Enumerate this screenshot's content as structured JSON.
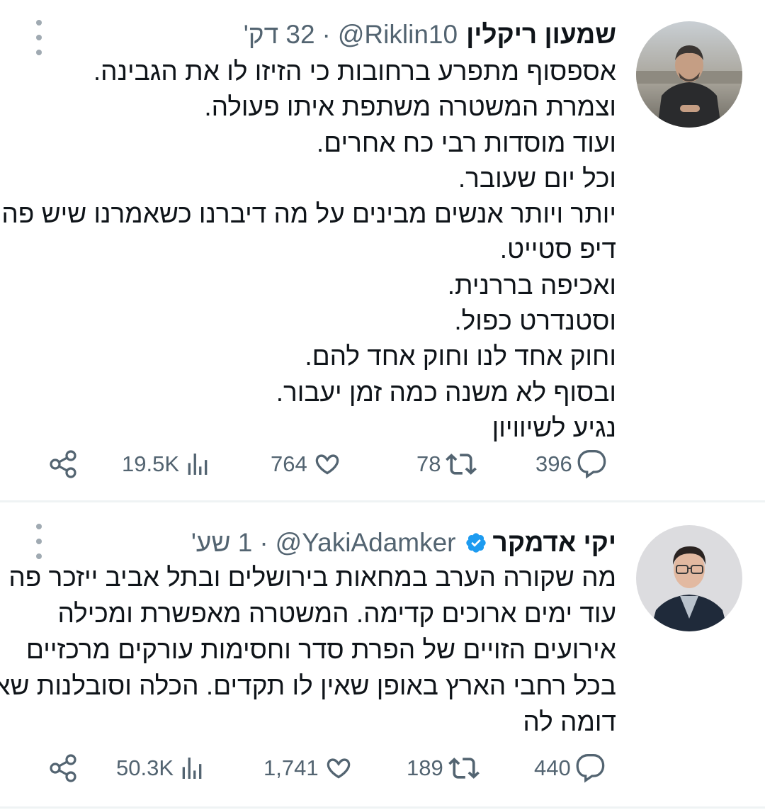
{
  "tweets": [
    {
      "author_name": "שמעון ריקלין",
      "handle": "@Riklin10",
      "time": "32 דק'",
      "verified": false,
      "lines": [
        "אספסוף מתפרע ברחובות כי הזיזו לו את הגבינה.",
        "וצמרת המשטרה משתפת איתו פעולה.",
        "ועוד מוסדות רבי כח אחרים.",
        "וכל יום שעובר.",
        "יותר ויותר אנשים מבינים על מה דיברנו כשאמרנו שיש פה",
        "דיפ סטייט.",
        "ואכיפה בררנית.",
        "וסטנדרט כפול.",
        "וחוק אחד לנו וחוק אחד להם.",
        "ובסוף לא משנה כמה זמן יעבור.",
        "נגיע לשיוויון"
      ],
      "stats": {
        "replies": "396",
        "retweets": "78",
        "likes": "764",
        "views": "19.5K"
      }
    },
    {
      "author_name": "יקי אדמקר",
      "handle": "@YakiAdamker",
      "time": "1 שע'",
      "verified": true,
      "lines": [
        "מה שקורה הערב במחאות בירושלים ובתל אביב ייזכר פה",
        "עוד ימים ארוכים קדימה. המשטרה מאפשרת ומכילה",
        "אירועים הזויים של הפרת סדר וחסימות עורקים מרכזיים",
        "בכל רחבי הארץ באופן שאין לו תקדים. הכלה וסובלנות שאין",
        "דומה לה"
      ],
      "stats": {
        "replies": "440",
        "retweets": "189",
        "likes": "1,741",
        "views": "50.3K"
      }
    }
  ],
  "colors": {
    "text": "#0f1419",
    "muted": "#536471",
    "verified": "#1d9bf0",
    "divider": "#eff3f4"
  },
  "icons": [
    "more-icon",
    "reply-icon",
    "retweet-icon",
    "like-icon",
    "views-icon",
    "share-icon",
    "verified-badge-icon"
  ]
}
